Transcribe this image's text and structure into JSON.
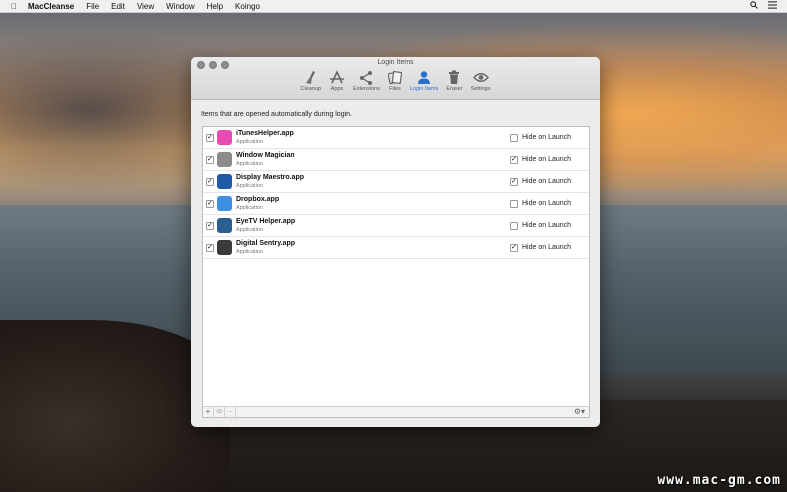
{
  "menubar": {
    "app_name": "MacCleanse",
    "items": [
      "File",
      "Edit",
      "View",
      "Window",
      "Help",
      "Koingo"
    ]
  },
  "window": {
    "title": "Login Items",
    "toolbar": [
      {
        "label": "Cleanup",
        "icon": "broom-icon"
      },
      {
        "label": "Apps",
        "icon": "apps-icon"
      },
      {
        "label": "Extensions",
        "icon": "share-icon"
      },
      {
        "label": "Files",
        "icon": "files-icon"
      },
      {
        "label": "Login Items",
        "icon": "user-icon"
      },
      {
        "label": "Eraser",
        "icon": "trash-icon"
      },
      {
        "label": "Settings",
        "icon": "eye-settings-icon"
      }
    ],
    "description": "Items that are opened automatically during login."
  },
  "login_items": [
    {
      "name": "iTunesHelper.app",
      "kind": "Application",
      "enabled": true,
      "hide": false,
      "icon_color": "#e94bb4"
    },
    {
      "name": "Window Magician",
      "kind": "Application",
      "enabled": true,
      "hide": true,
      "icon_color": "#8b8b8b"
    },
    {
      "name": "Display Maestro.app",
      "kind": "Application",
      "enabled": true,
      "hide": true,
      "icon_color": "#1f5aa8"
    },
    {
      "name": "Dropbox.app",
      "kind": "Application",
      "enabled": true,
      "hide": false,
      "icon_color": "#3d8fe0"
    },
    {
      "name": "EyeTV Helper.app",
      "kind": "Application",
      "enabled": true,
      "hide": false,
      "icon_color": "#2a5f8f"
    },
    {
      "name": "Digital Sentry.app",
      "kind": "Application",
      "enabled": true,
      "hide": true,
      "icon_color": "#3a3a3a"
    }
  ],
  "hide_label": "Hide on Launch",
  "bottom_bar": {
    "add": "+",
    "remove": "−"
  },
  "accent_color": "#2a6fcf",
  "watermark": "www.mac-gm.com"
}
